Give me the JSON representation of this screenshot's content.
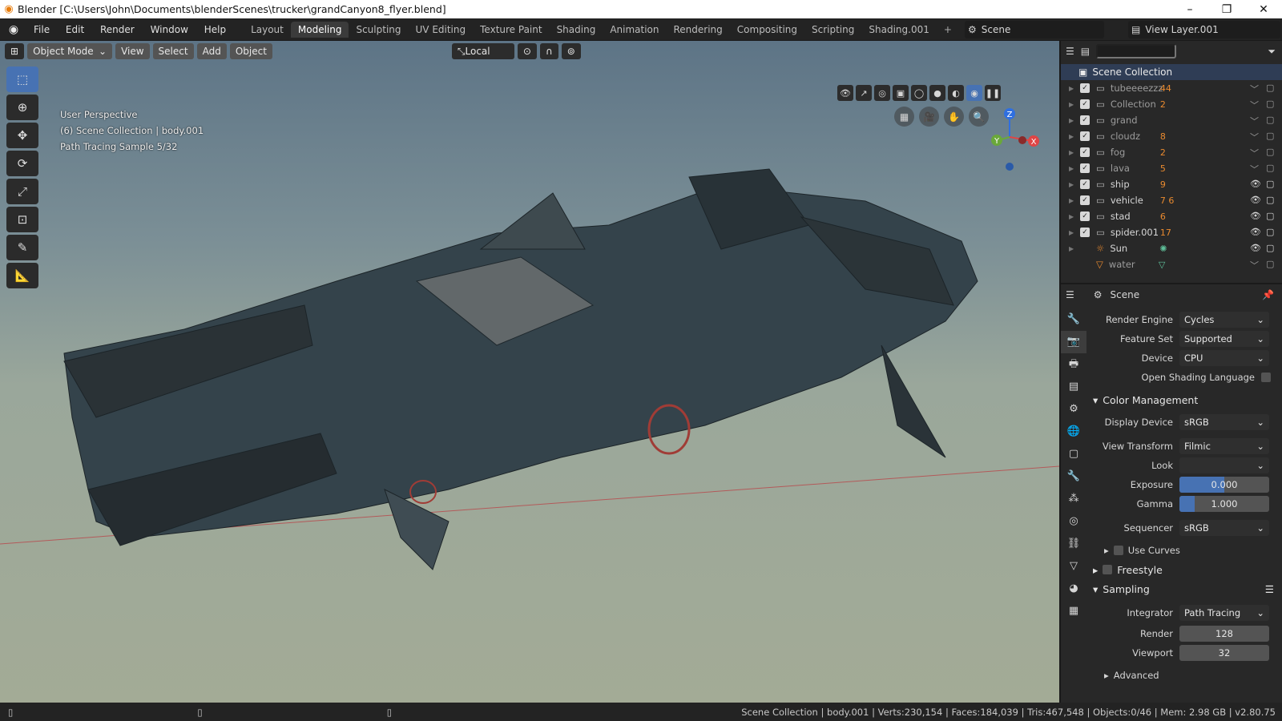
{
  "window": {
    "title": "Blender [C:\\Users\\John\\Documents\\blenderScenes\\trucker\\grandCanyon8_flyer.blend]"
  },
  "menu": [
    "File",
    "Edit",
    "Render",
    "Window",
    "Help"
  ],
  "workspaces": [
    "Layout",
    "Modeling",
    "Sculpting",
    "UV Editing",
    "Texture Paint",
    "Shading",
    "Animation",
    "Rendering",
    "Compositing",
    "Scripting",
    "Shading.001"
  ],
  "workspace_add": "+",
  "active_workspace": "Modeling",
  "scene": {
    "name": "Scene",
    "view_layer": "View Layer.001"
  },
  "viewport": {
    "mode": "Object Mode",
    "menus": [
      "View",
      "Select",
      "Add",
      "Object"
    ],
    "orientation": "Local",
    "overlay_lines": [
      "User Perspective",
      "(6) Scene Collection | body.001",
      "Path Tracing Sample 5/32"
    ],
    "gizmo_labels": {
      "z": "Z",
      "y": "Y",
      "x": "X"
    }
  },
  "outliner": {
    "root": "Scene Collection",
    "search_placeholder": "",
    "items": [
      {
        "name": "tubeeeezzz",
        "badge": "44",
        "visible": false
      },
      {
        "name": "Collection",
        "badge": "2",
        "visible": false
      },
      {
        "name": "grand",
        "badge": "",
        "visible": false
      },
      {
        "name": "cloudz",
        "badge": "8",
        "visible": false
      },
      {
        "name": "fog",
        "badge": "2",
        "visible": false
      },
      {
        "name": "lava",
        "badge": "5",
        "visible": false
      },
      {
        "name": "ship",
        "badge": "9",
        "visible": true
      },
      {
        "name": "vehicle",
        "badge": "7 6",
        "visible": true
      },
      {
        "name": "stad",
        "badge": "6",
        "visible": true
      },
      {
        "name": "spider.001",
        "badge": "17",
        "visible": true
      },
      {
        "name": "Sun",
        "badge": "",
        "visible": true
      },
      {
        "name": "water",
        "badge": "",
        "visible": false
      }
    ]
  },
  "properties": {
    "context": "Scene",
    "render_engine": {
      "label": "Render Engine",
      "value": "Cycles"
    },
    "feature_set": {
      "label": "Feature Set",
      "value": "Supported"
    },
    "device": {
      "label": "Device",
      "value": "CPU"
    },
    "osl": "Open Shading Language",
    "color_management": {
      "title": "Color Management",
      "display_device": {
        "label": "Display Device",
        "value": "sRGB"
      },
      "view_transform": {
        "label": "View Transform",
        "value": "Filmic"
      },
      "look": {
        "label": "Look",
        "value": ""
      },
      "exposure": {
        "label": "Exposure",
        "value": "0.000",
        "fill": 0.5
      },
      "gamma": {
        "label": "Gamma",
        "value": "1.000",
        "fill": 0.17
      },
      "sequencer": {
        "label": "Sequencer",
        "value": "sRGB"
      },
      "use_curves": "Use Curves"
    },
    "freestyle": "Freestyle",
    "sampling": {
      "title": "Sampling",
      "integrator": {
        "label": "Integrator",
        "value": "Path Tracing"
      },
      "render": {
        "label": "Render",
        "value": "128"
      },
      "viewport": {
        "label": "Viewport",
        "value": "32"
      },
      "advanced": "Advanced"
    }
  },
  "status": "Scene Collection | body.001 | Verts:230,154 | Faces:184,039 | Tris:467,548 | Objects:0/46 | Mem: 2.98 GB | v2.80.75",
  "colors": {
    "accent": "#4772b3",
    "highlight": "#e87d0d"
  }
}
